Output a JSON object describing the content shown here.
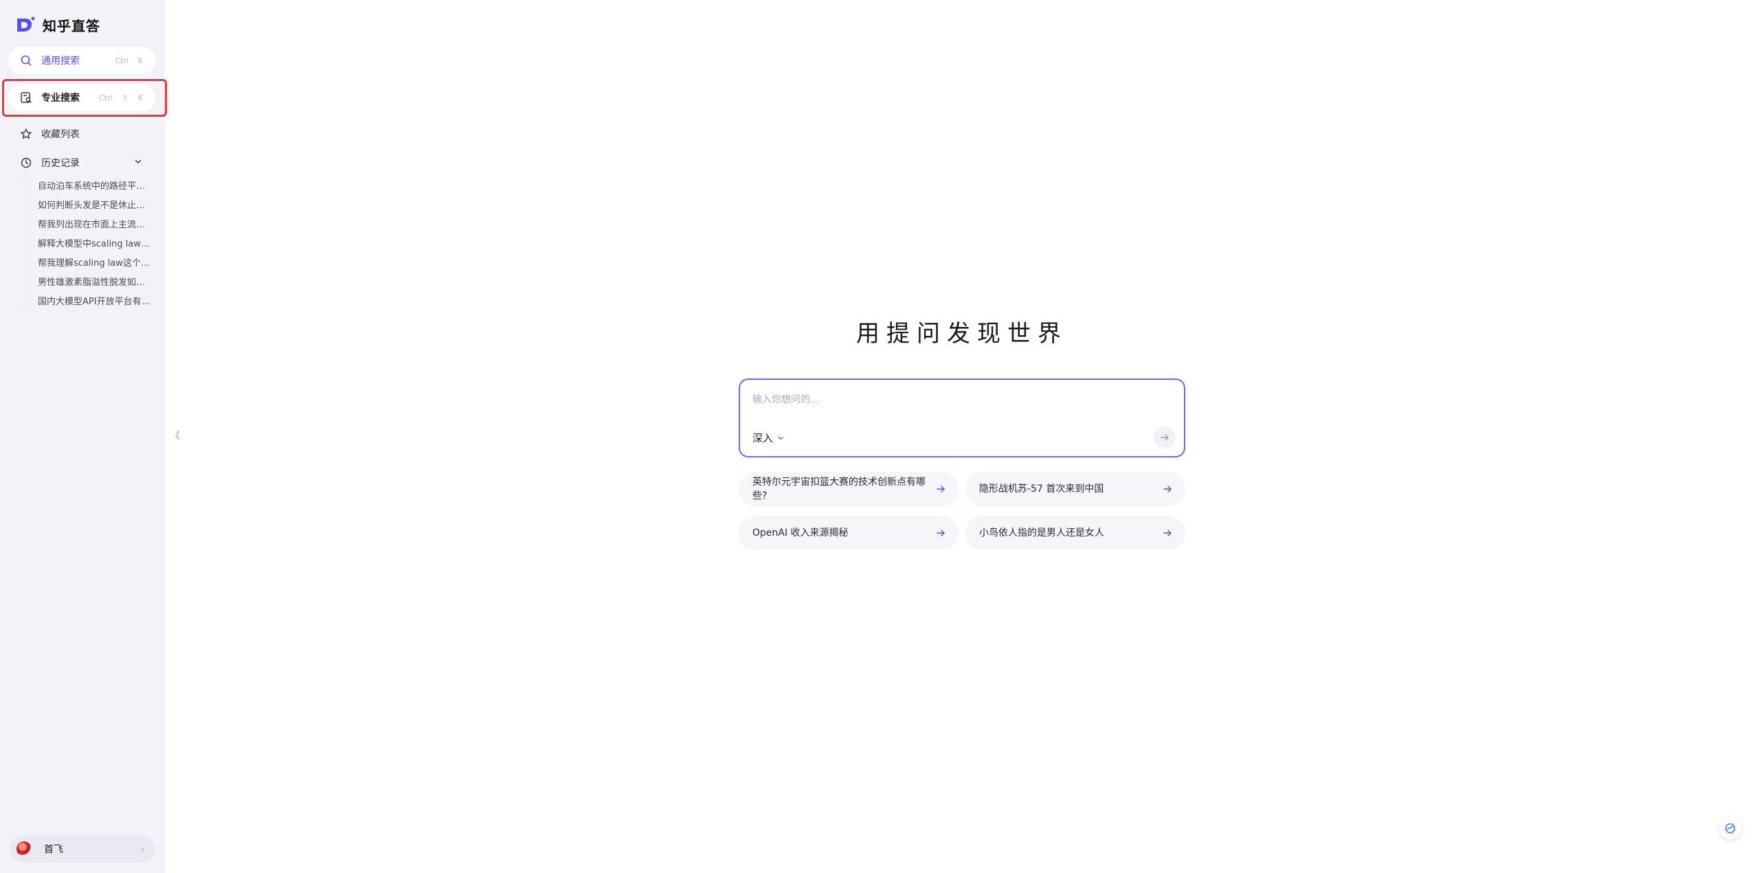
{
  "app": {
    "brand": "知乎直答",
    "brand_color": "#5b4fe6"
  },
  "sidebar": {
    "general_search": {
      "label": "通用搜索",
      "shortcut": [
        "Ctrl",
        "K"
      ],
      "icon": "search-icon"
    },
    "pro_search": {
      "label": "专业搜索",
      "shortcut": [
        "Ctrl",
        "⇧",
        "K"
      ],
      "icon": "document-search-icon"
    },
    "favorites": {
      "label": "收藏列表",
      "icon": "star-icon"
    },
    "history": {
      "label": "历史记录",
      "icon": "clock-icon",
      "items": [
        "自动泊车系统中的路径平…",
        "如何判断头发是不是休止…",
        "帮我列出现在市面上主流…",
        "解释大模型中scaling law …",
        "帮我理解scaling law这个…",
        "男性雄激素脂溢性脱发如…",
        "国内大模型API开放平台有…"
      ]
    },
    "user": {
      "name": "首飞"
    },
    "collapse_glyph": "《"
  },
  "main": {
    "headline": "用提问发现世界",
    "ask": {
      "placeholder": "输入你想问的...",
      "mode": "深入"
    },
    "suggestions": [
      "英特尔元宇宙扣篮大赛的技术创新点有哪些?",
      "隐形战机苏-57 首次来到中国",
      "OpenAI 收入来源揭秘",
      "小鸟依人指的是男人还是女人"
    ]
  },
  "colors": {
    "accent": "#7b61ff",
    "highlight": "#e53935",
    "sidebar_bg": "#f2f3f8"
  }
}
